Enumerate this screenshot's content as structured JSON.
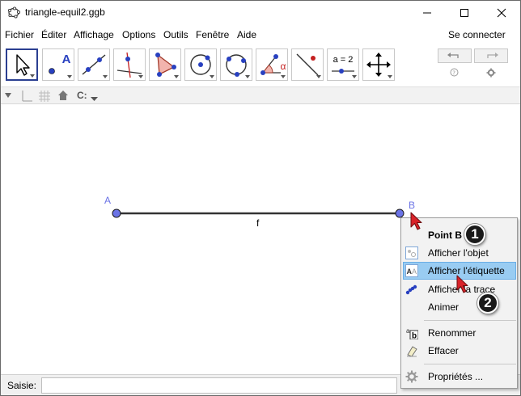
{
  "window": {
    "title": "triangle-equil2.ggb"
  },
  "menubar": {
    "items": [
      "Fichier",
      "Éditer",
      "Affichage",
      "Options",
      "Outils",
      "Fenêtre",
      "Aide"
    ],
    "connect_label": "Se connecter"
  },
  "toolbar": {
    "tools": [
      {
        "name": "move-tool-icon",
        "selected": true
      },
      {
        "name": "point-tool-icon",
        "label": "A"
      },
      {
        "name": "line-tool-icon"
      },
      {
        "name": "perpendicular-tool-icon"
      },
      {
        "name": "polygon-tool-icon"
      },
      {
        "name": "circle-center-tool-icon"
      },
      {
        "name": "circle-three-points-tool-icon"
      },
      {
        "name": "angle-tool-icon",
        "label": "α"
      },
      {
        "name": "reflect-tool-icon"
      },
      {
        "name": "slider-tool-icon",
        "label": "a = 2"
      },
      {
        "name": "move-view-tool-icon"
      }
    ]
  },
  "stylebar": {
    "point_capture_label": "C:"
  },
  "graphics": {
    "point_a_label": "A",
    "point_b_label": "B",
    "segment_label": "f",
    "point_color": "#6b73e6",
    "label_color": "#6b73e6"
  },
  "context_menu": {
    "title": "Point B",
    "items": [
      {
        "label": "Afficher l'objet",
        "icon": "show-object-icon"
      },
      {
        "label": "Afficher l'étiquette",
        "icon": "show-label-icon",
        "highlighted": true
      },
      {
        "label": "Afficher la trace",
        "icon": "trace-icon"
      },
      {
        "label": "Animer",
        "icon": ""
      },
      {
        "label": "Renommer",
        "icon": "rename-icon"
      },
      {
        "label": "Effacer",
        "icon": "eraser-icon"
      },
      {
        "label": "Propriétés ...",
        "icon": "properties-gear-icon"
      }
    ]
  },
  "callouts": [
    "1",
    "2"
  ],
  "inputbar": {
    "label": "Saisie:",
    "value": "",
    "placeholder": ""
  },
  "colors": {
    "highlight": "#99ccf2",
    "selected_tool_border": "#2b3f91",
    "cursor": "#d9232a"
  }
}
